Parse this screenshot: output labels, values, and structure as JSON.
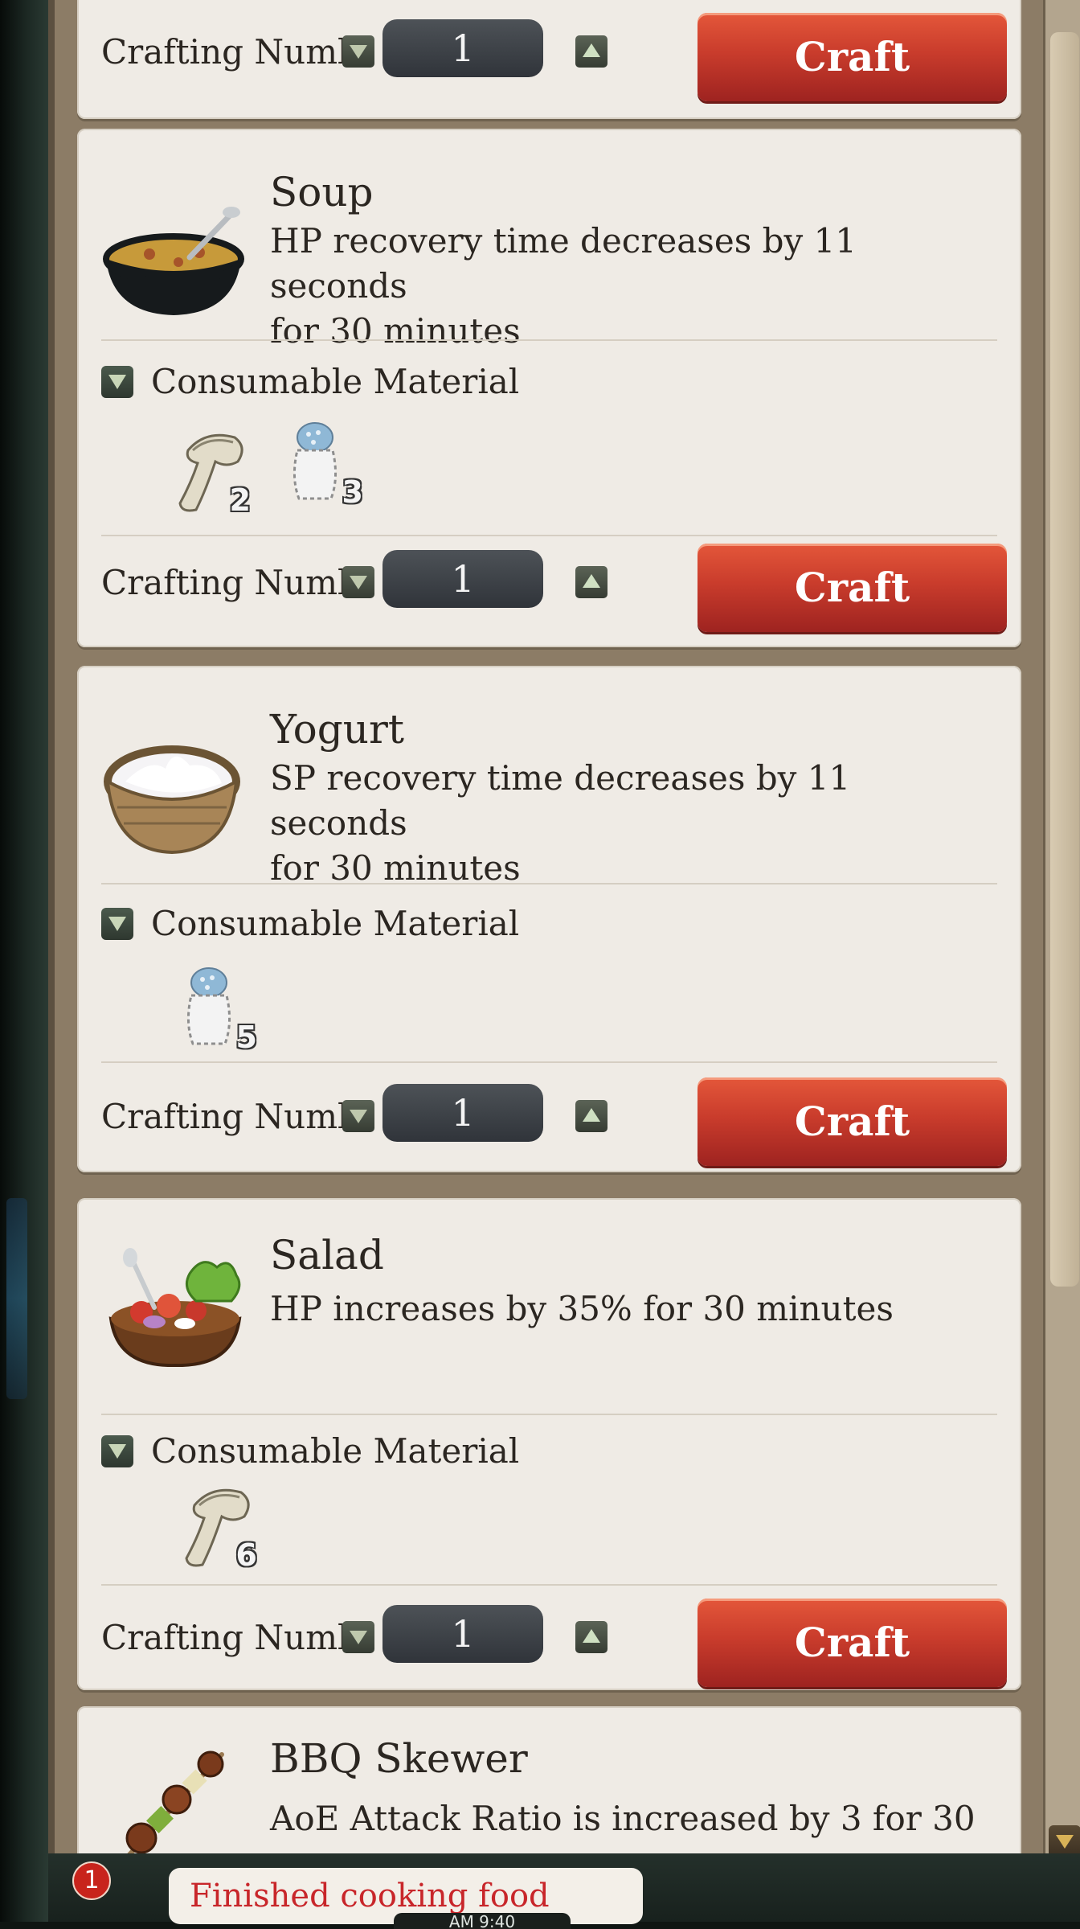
{
  "craft_label": "Craft",
  "crafting_number_label": "Crafting Numb",
  "consumable_label": "Consumable Material",
  "recipes": [
    {
      "name": "",
      "crafting_number": "1"
    },
    {
      "name": "Soup",
      "desc_line1": "HP recovery time decreases by 11 seconds",
      "desc_line2": "for 30 minutes",
      "materials": [
        {
          "icon": "mushroom-icon",
          "qty": "2"
        },
        {
          "icon": "salt-shaker-icon",
          "qty": "3"
        }
      ],
      "crafting_number": "1"
    },
    {
      "name": "Yogurt",
      "desc_line1": "SP recovery time decreases by 11 seconds",
      "desc_line2": "for 30 minutes",
      "materials": [
        {
          "icon": "salt-shaker-icon",
          "qty": "5"
        }
      ],
      "crafting_number": "1"
    },
    {
      "name": "Salad",
      "desc_line1": "HP increases by 35% for 30 minutes",
      "materials": [
        {
          "icon": "mushroom-icon",
          "qty": "6"
        }
      ],
      "crafting_number": "1"
    },
    {
      "name": "BBQ Skewer",
      "desc_line1": "AoE Attack Ratio is increased by 3 for 30"
    }
  ],
  "notification": {
    "count": "1",
    "message": "Finished cooking food",
    "clock": "AM 9:40"
  },
  "colors": {
    "craft_button": "#c93c2c",
    "notification_text": "#c8262a",
    "card_bg": "#efebe5"
  }
}
